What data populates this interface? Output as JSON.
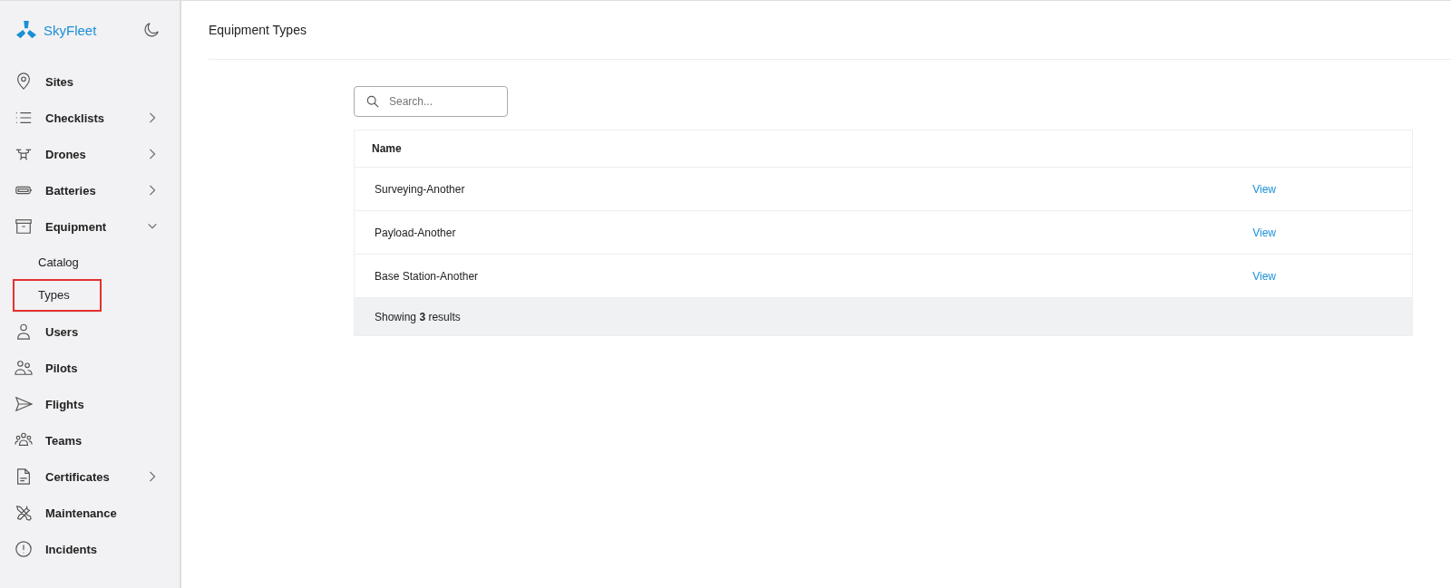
{
  "sidebar": {
    "brand": "SkyFleet",
    "items": [
      {
        "label": "Sites"
      },
      {
        "label": "Checklists",
        "expanded": false
      },
      {
        "label": "Drones",
        "expanded": false
      },
      {
        "label": "Batteries",
        "expanded": false
      },
      {
        "label": "Equipment",
        "expanded": true,
        "children": [
          {
            "label": "Catalog",
            "selected": false
          },
          {
            "label": "Types",
            "selected": true
          }
        ]
      },
      {
        "label": "Users"
      },
      {
        "label": "Pilots"
      },
      {
        "label": "Flights"
      },
      {
        "label": "Teams"
      },
      {
        "label": "Certificates",
        "expanded": false
      },
      {
        "label": "Maintenance"
      },
      {
        "label": "Incidents"
      }
    ]
  },
  "page": {
    "title": "Equipment Types"
  },
  "search": {
    "placeholder": "Search..."
  },
  "table": {
    "columns": [
      "Name"
    ],
    "rows": [
      {
        "name": "Surveying-Another",
        "action": "View"
      },
      {
        "name": "Payload-Another",
        "action": "View"
      },
      {
        "name": "Base Station-Another",
        "action": "View"
      }
    ],
    "footer": "Showing **3** results"
  }
}
